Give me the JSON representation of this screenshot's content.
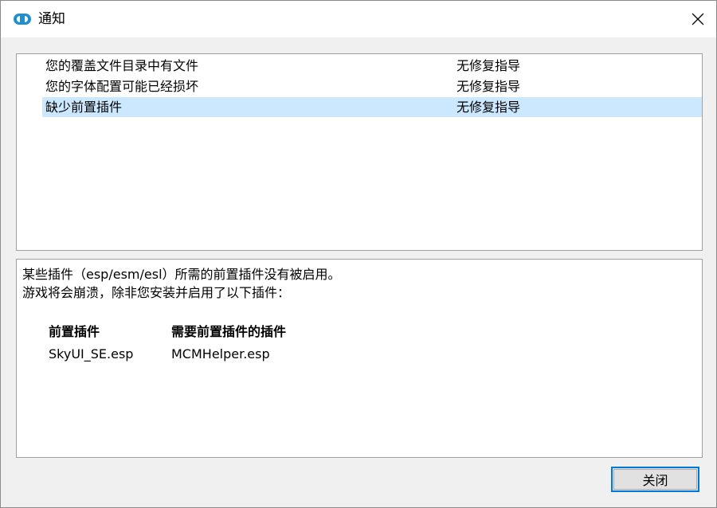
{
  "window": {
    "title": "通知",
    "icon": "app-logo-icon",
    "close_icon": "close-icon"
  },
  "notifications": [
    {
      "message": "您的覆盖文件目录中有文件",
      "fix": "无修复指导",
      "selected": false
    },
    {
      "message": "您的字体配置可能已经损坏",
      "fix": "无修复指导",
      "selected": false
    },
    {
      "message": "缺少前置插件",
      "fix": "无修复指导",
      "selected": true
    }
  ],
  "detail": {
    "line1": "某些插件（esp/esm/esl）所需的前置插件没有被启用。",
    "line2": "游戏将会崩溃，除非您安装并启用了以下插件：",
    "table": {
      "headers": [
        "前置插件",
        "需要前置插件的插件"
      ],
      "rows": [
        [
          "SkyUI_SE.esp",
          "MCMHelper.esp"
        ]
      ]
    }
  },
  "buttons": {
    "close_label": "关闭"
  },
  "colors": {
    "selection": "#cce8ff",
    "button_focus_border": "#0078d7"
  }
}
